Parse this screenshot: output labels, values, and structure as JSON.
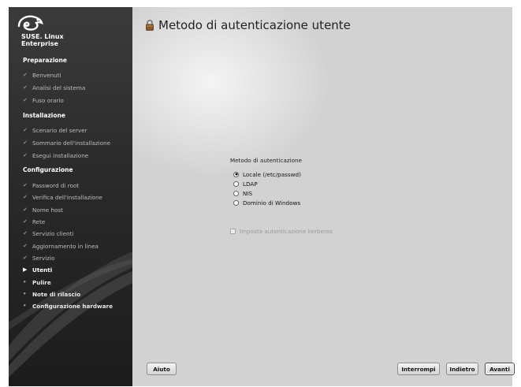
{
  "brand": {
    "line1": "SUSE. Linux",
    "line2": "Enterprise"
  },
  "sidebar": {
    "sections": [
      {
        "label": "Preparazione"
      },
      {
        "label": "Installazione"
      },
      {
        "label": "Configurazione"
      }
    ],
    "steps": [
      {
        "label": "Benvenuti",
        "state": "done"
      },
      {
        "label": "Analisi del sistema",
        "state": "done"
      },
      {
        "label": "Fuso orario",
        "state": "done"
      },
      {
        "label": "Scenario del server",
        "state": "done"
      },
      {
        "label": "Sommario dell'installazione",
        "state": "done"
      },
      {
        "label": "Esegui installazione",
        "state": "done"
      },
      {
        "label": "Password di root",
        "state": "done"
      },
      {
        "label": "Verifica dell'installazione",
        "state": "done"
      },
      {
        "label": "Nome host",
        "state": "done"
      },
      {
        "label": "Rete",
        "state": "done"
      },
      {
        "label": "Servizio clienti",
        "state": "done"
      },
      {
        "label": "Aggiornamento in linea",
        "state": "done"
      },
      {
        "label": "Servizio",
        "state": "done"
      },
      {
        "label": "Utenti",
        "state": "current"
      },
      {
        "label": "Pulire",
        "state": "pending"
      },
      {
        "label": "Note di rilascio",
        "state": "pending"
      },
      {
        "label": "Configurazione hardware",
        "state": "pending"
      }
    ]
  },
  "page": {
    "title": "Metodo di autenticazione utente"
  },
  "auth": {
    "group_label": "Metodo di autenticazione",
    "options": [
      {
        "label": "Locale (/etc/passwd)",
        "selected": true
      },
      {
        "label": "LDAP",
        "selected": false
      },
      {
        "label": "NIS",
        "selected": false
      },
      {
        "label": "Dominio di Windows",
        "selected": false
      }
    ],
    "kerberos_label": "Imposta autenticazione kerberos",
    "kerberos_enabled": false
  },
  "buttons": {
    "help": "Aiuto",
    "abort": "Interrompi",
    "back": "Indietro",
    "next": "Avanti"
  },
  "icons": {
    "done": "checkmark-icon",
    "current": "arrow-right-icon",
    "pending": "bullet-icon",
    "title": "lock-icon"
  }
}
